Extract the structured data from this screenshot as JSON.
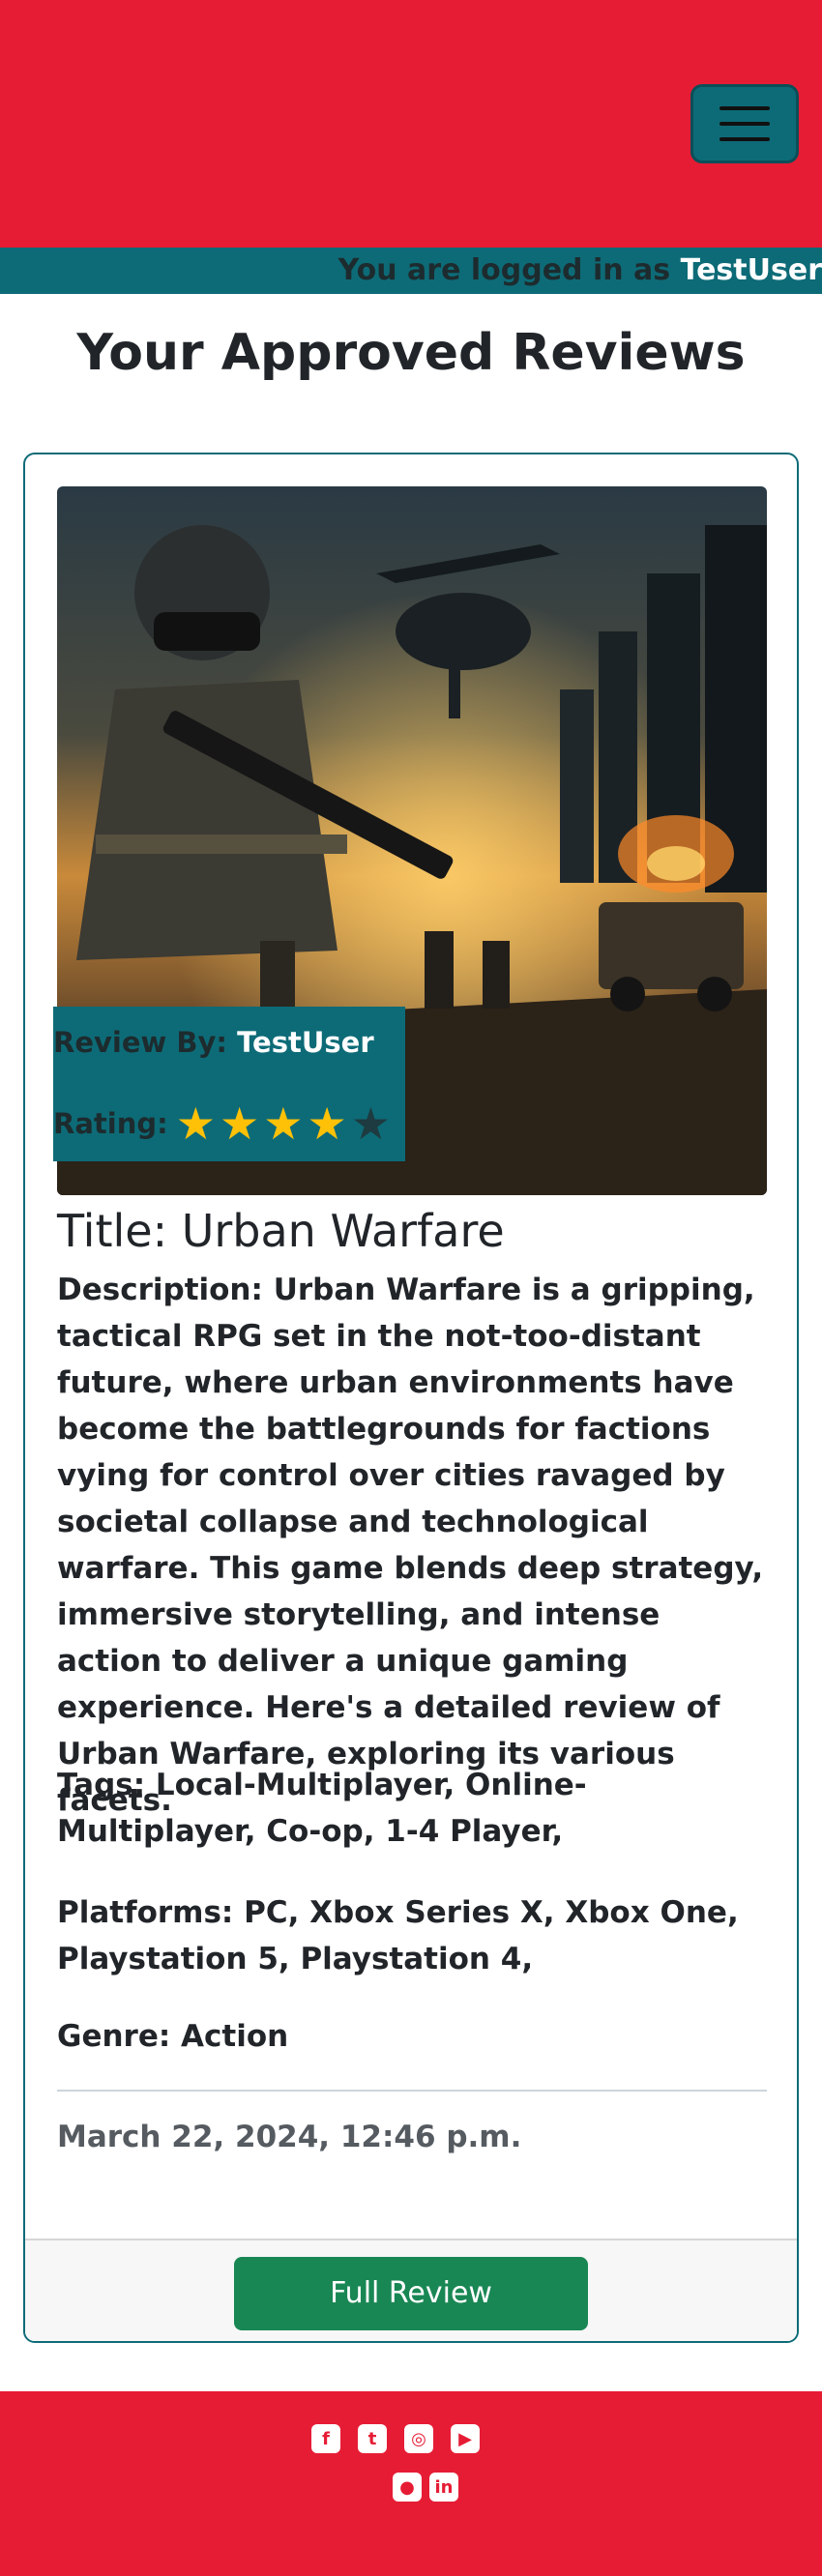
{
  "header": {
    "menu_icon": "hamburger-icon",
    "brand_color": "#e61c35",
    "accent_color": "#0d6b77",
    "login_prefix": "You are logged in as ",
    "login_user": "TestUser"
  },
  "page": {
    "heading": "Your Approved Reviews"
  },
  "review": {
    "image_alt": "Urban Warfare cover art",
    "review_by_label": "Review By:",
    "review_by_user": "TestUser",
    "rating_label": "Rating:",
    "rating": 4,
    "rating_max": 5,
    "title": "Title: Urban Warfare",
    "description": "Description: Urban Warfare is a gripping, tactical RPG set in the not-too-distant future, where urban environments have become the battlegrounds for factions vying for control over cities ravaged by societal collapse and technological warfare. This game blends deep strategy, immersive storytelling, and intense action to deliver a unique gaming experience. Here's a detailed review of Urban Warfare, exploring its various facets.",
    "tags": "Tags: Local-Multiplayer, Online-Multiplayer, Co-op, 1-4 Player,",
    "platforms": "Platforms: PC, Xbox Series X, Xbox One, Playstation 5, Playstation 4,",
    "genre": "Genre: Action",
    "date": "March 22, 2024, 12:46 p.m.",
    "button_label": "Full Review",
    "button_color": "#198754"
  },
  "footer": {
    "social_icons": [
      "facebook-icon",
      "twitter-icon",
      "instagram-icon",
      "youtube-icon",
      "github-icon",
      "linkedin-icon"
    ]
  }
}
